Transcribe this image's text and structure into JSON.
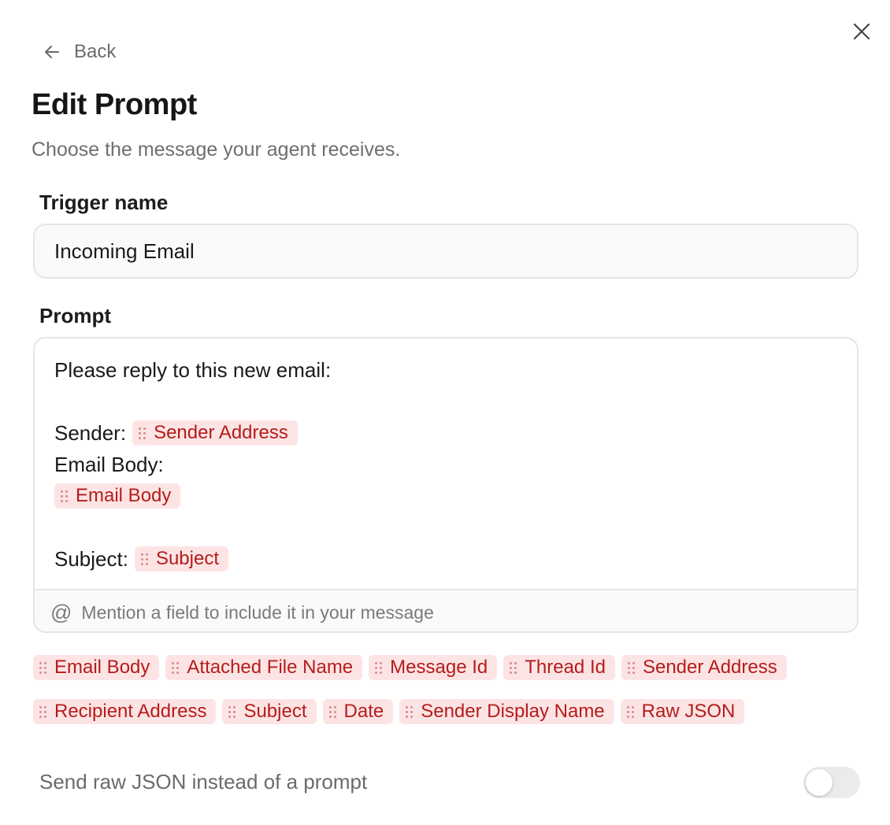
{
  "header": {
    "back_label": "Back",
    "title": "Edit Prompt",
    "subtitle": "Choose the message your agent receives."
  },
  "trigger": {
    "label": "Trigger name",
    "value": "Incoming Email"
  },
  "prompt": {
    "label": "Prompt",
    "lines": {
      "intro": "Please reply to this new email:",
      "sender_text": "Sender:",
      "sender_chip": "Sender Address",
      "body_text": "Email Body:",
      "body_chip": "Email Body",
      "subject_text": "Subject:",
      "subject_chip": "Subject"
    },
    "mention_hint": "Mention a field to include it in your message"
  },
  "fields": [
    "Email Body",
    "Attached File Name",
    "Message Id",
    "Thread Id",
    "Sender Address",
    "Recipient Address",
    "Subject",
    "Date",
    "Sender Display Name",
    "Raw JSON"
  ],
  "raw_json_toggle": {
    "label": "Send raw JSON instead of a prompt",
    "enabled": false
  },
  "colors": {
    "chip_bg": "#fde4e4",
    "chip_text": "#b51c1c"
  }
}
